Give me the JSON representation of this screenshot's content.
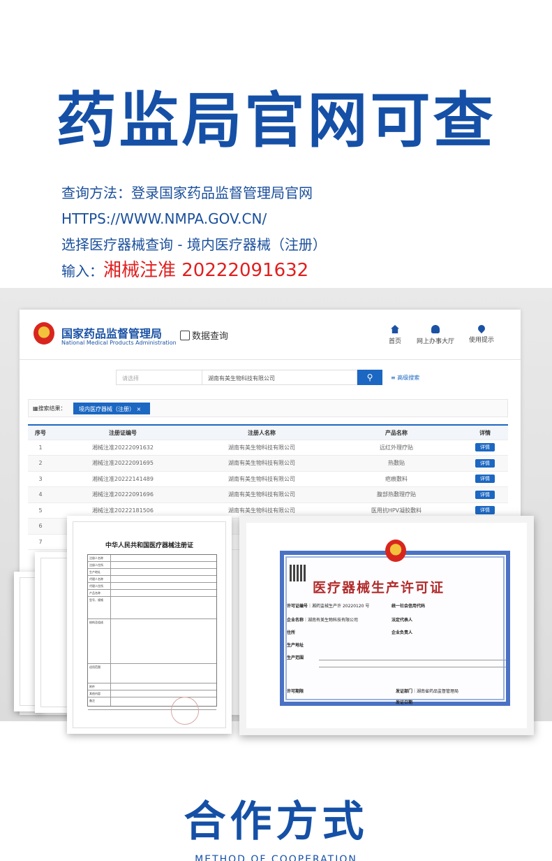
{
  "hero": {
    "title": "药监局官网可查"
  },
  "instructions": {
    "line1": "查询方法：登录国家药品监督管理局官网",
    "line2": "HTTPS://WWW.NMPA.GOV.CN/",
    "line3": "选择医疗器械查询 - 境内医疗器械（注册）",
    "line4_prefix": "输入：",
    "line4_value": "湘械注准 20222091632"
  },
  "site": {
    "title_cn": "国家药品监督管理局",
    "title_en": "National Medical Products Administration",
    "data_query": "数据查询",
    "nav": [
      {
        "label": "首页",
        "icon": "home-icon"
      },
      {
        "label": "网上办事大厅",
        "icon": "user-icon"
      },
      {
        "label": "使用提示",
        "icon": "pin-icon"
      }
    ],
    "search": {
      "select_placeholder": "请选择",
      "query": "湖南有美生物科技有限公司",
      "advanced": "高级搜索"
    },
    "result_label": "搜索结果：",
    "result_tag": "境内医疗器械（注册）",
    "table": {
      "headers": [
        "序号",
        "注册证编号",
        "注册人名称",
        "产品名称",
        "详情"
      ],
      "detail_label": "详情",
      "rows": [
        {
          "no": "1",
          "code": "湘械注准20222091632",
          "company": "湖南有美生物科技有限公司",
          "product": "远红外理疗贴"
        },
        {
          "no": "2",
          "code": "湘械注准20222091695",
          "company": "湖南有美生物科技有限公司",
          "product": "热敷贴"
        },
        {
          "no": "3",
          "code": "湘械注准20222141489",
          "company": "湖南有美生物科技有限公司",
          "product": "疤痕敷料"
        },
        {
          "no": "4",
          "code": "湘械注准20222091696",
          "company": "湖南有美生物科技有限公司",
          "product": "腹部热敷理疗贴"
        },
        {
          "no": "5",
          "code": "湘械注准20222181506",
          "company": "湖南有美生物科技有限公司",
          "product": "医用抗HPV凝胶敷料"
        },
        {
          "no": "6",
          "code": "",
          "company": "",
          "product": ""
        },
        {
          "no": "7",
          "code": "",
          "company": "",
          "product": ""
        }
      ]
    }
  },
  "registration_cert": {
    "title": "中华人民共和国医疗器械注册证",
    "fields": [
      "注册人名称",
      "注册人住所",
      "生产地址",
      "代理人名称",
      "代理人住所",
      "产品名称",
      "型号、规格",
      "结构及组成",
      "适用范围",
      "附件",
      "其他内容",
      "备注"
    ]
  },
  "license_cert": {
    "title": "医疗器械生产许可证",
    "fields": {
      "permit_no_label": "许可证编号",
      "permit_no": "湘药监械生产许 20220120 号",
      "credit_code_label": "统一社会信用代码",
      "company_label": "企业名称",
      "company": "湖南有美生物科技有限公司",
      "legal_label": "法定代表人",
      "residence_label": "住所",
      "owner_label": "企业负责人",
      "address_label": "生产地址",
      "scope_label": "生产范围",
      "valid_label": "许可期限",
      "issuer_label": "发证部门",
      "issuer": "湖南省药品监督管理局",
      "issue_date_label": "发证日期"
    }
  },
  "footer": {
    "title": "合作方式",
    "subtitle": "METHOD OF COOPERATION"
  },
  "colors": {
    "brand_blue": "#1550a6",
    "accent_red": "#e02020",
    "button_blue": "#1b67c2"
  }
}
